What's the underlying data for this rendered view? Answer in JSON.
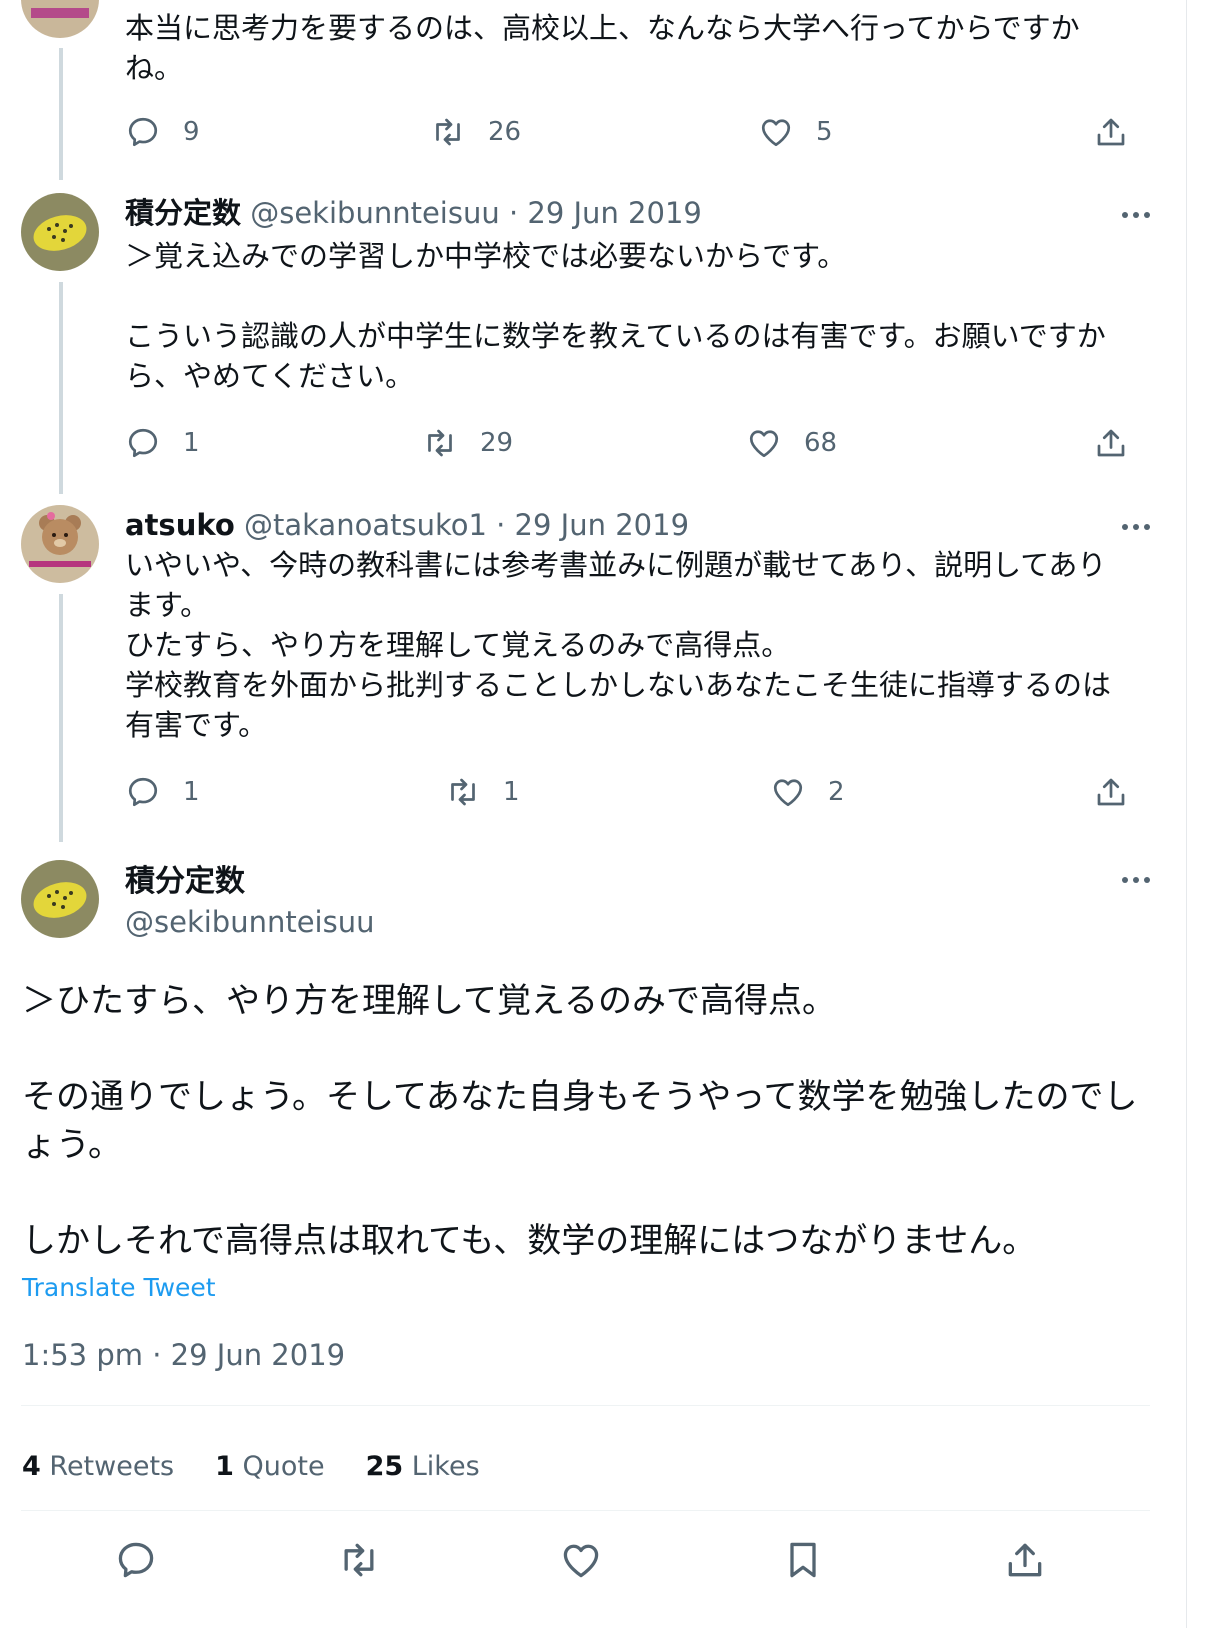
{
  "tweets": [
    {
      "text": "本当に思考力を要するのは、高校以上、なんなら大学へ行ってからですか\nね。",
      "replies": "9",
      "retweets": "26",
      "likes": "5"
    },
    {
      "name": "積分定数",
      "handle": "@sekibunnteisuu",
      "date": "· 29 Jun 2019",
      "text": "＞覚え込みでの学習しか中学校では必要ないからです。\n\nこういう認識の人が中学生に数学を教えているのは有害です。お願いですか\nら、やめてください。",
      "replies": "1",
      "retweets": "29",
      "likes": "68"
    },
    {
      "name": "atsuko",
      "handle": "@takanoatsuko1",
      "date": "· 29 Jun 2019",
      "text": "いやいや、今時の教科書には参考書並みに例題が載せてあり、説明してあり\nます。\nひたすら、やり方を理解して覚えるのみで高得点。\n学校教育を外面から批判することしかしないあなたこそ生徒に指導するのは\n有害です。",
      "replies": "1",
      "retweets": "1",
      "likes": "2"
    }
  ],
  "main_tweet": {
    "name": "積分定数",
    "handle": "@sekibunnteisuu",
    "text": "＞ひたすら、やり方を理解して覚えるのみで高得点。\n\nその通りでしょう。そしてあなた自身もそうやって数学を勉強したのでし\nょう。\n\nしかしそれで高得点は取れても、数学の理解にはつながりません。",
    "translate_label": "Translate Tweet",
    "timestamp": "1:53 pm · 29 Jun 2019",
    "stats": {
      "retweets_count": "4",
      "retweets_label": "Retweets",
      "quotes_count": "1",
      "quotes_label": "Quote",
      "likes_count": "25",
      "likes_label": "Likes"
    }
  },
  "icons": {
    "reply": "reply-icon",
    "retweet": "retweet-icon",
    "like": "like-icon",
    "share": "share-icon",
    "bookmark": "bookmark-icon",
    "more": "more-icon"
  },
  "colors": {
    "text": "#0f1419",
    "secondary": "#536471",
    "link": "#1d9bf0",
    "thread_line": "#cfd9de"
  }
}
